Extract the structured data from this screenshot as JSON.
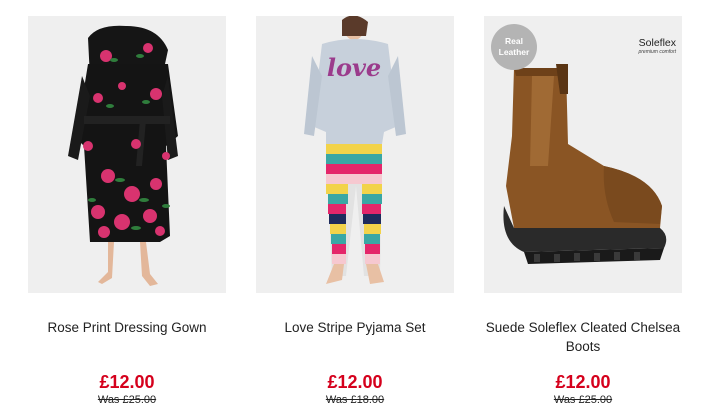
{
  "products": [
    {
      "name": "Rose Print Dressing Gown",
      "price": "£12.00",
      "was_price": "Was £25.00",
      "image_icon": "dressing-gown-image"
    },
    {
      "name": "Love Stripe Pyjama Set",
      "price": "£12.00",
      "was_price": "Was £18.00",
      "image_icon": "pyjama-set-image",
      "print_text": "love"
    },
    {
      "name": "Suede Soleflex Cleated Chelsea Boots",
      "price": "£12.00",
      "was_price": "Was £25.00",
      "image_icon": "chelsea-boot-image",
      "badge": "Real Leather",
      "brand": "Soleflex",
      "brand_tagline": "premium comfort"
    }
  ],
  "colors": {
    "price_red": "#d5001c",
    "image_background": "#efefef",
    "badge_grey": "#b4b4b4"
  }
}
